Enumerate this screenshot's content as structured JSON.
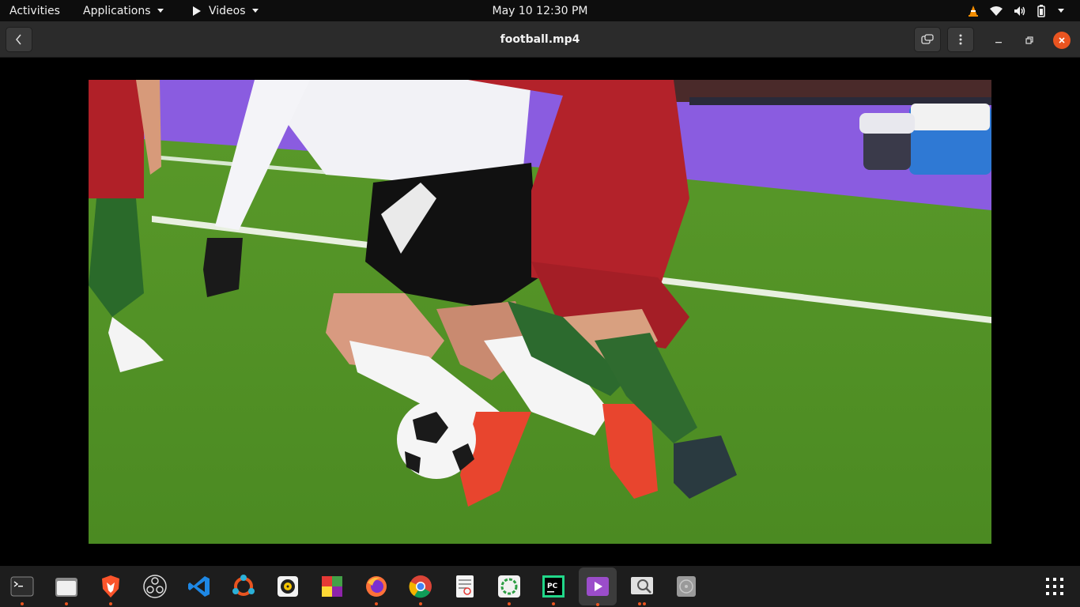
{
  "topbar": {
    "activities": "Activities",
    "applications": "Applications",
    "videos": "Videos",
    "clock": "May 10  12:30 PM"
  },
  "header": {
    "title": "football.mp4"
  },
  "colors": {
    "accent": "#e95420",
    "topbar_bg": "#0d0d0d",
    "header_bg": "#2b2b2b",
    "dock_bg": "#1d1d1d"
  },
  "dock": {
    "items": [
      {
        "name": "terminal-icon"
      },
      {
        "name": "files-icon"
      },
      {
        "name": "brave-icon"
      },
      {
        "name": "obs-icon"
      },
      {
        "name": "vscode-icon"
      },
      {
        "name": "ubuntu-software-icon"
      },
      {
        "name": "rhythmbox-icon"
      },
      {
        "name": "colorful-app-icon"
      },
      {
        "name": "firefox-icon"
      },
      {
        "name": "chrome-icon"
      },
      {
        "name": "document-viewer-icon"
      },
      {
        "name": "circle-app-icon"
      },
      {
        "name": "pycharm-icon"
      },
      {
        "name": "videos-icon"
      },
      {
        "name": "image-viewer-icon"
      },
      {
        "name": "disc-icon"
      }
    ],
    "pycharm_label": "PC"
  }
}
